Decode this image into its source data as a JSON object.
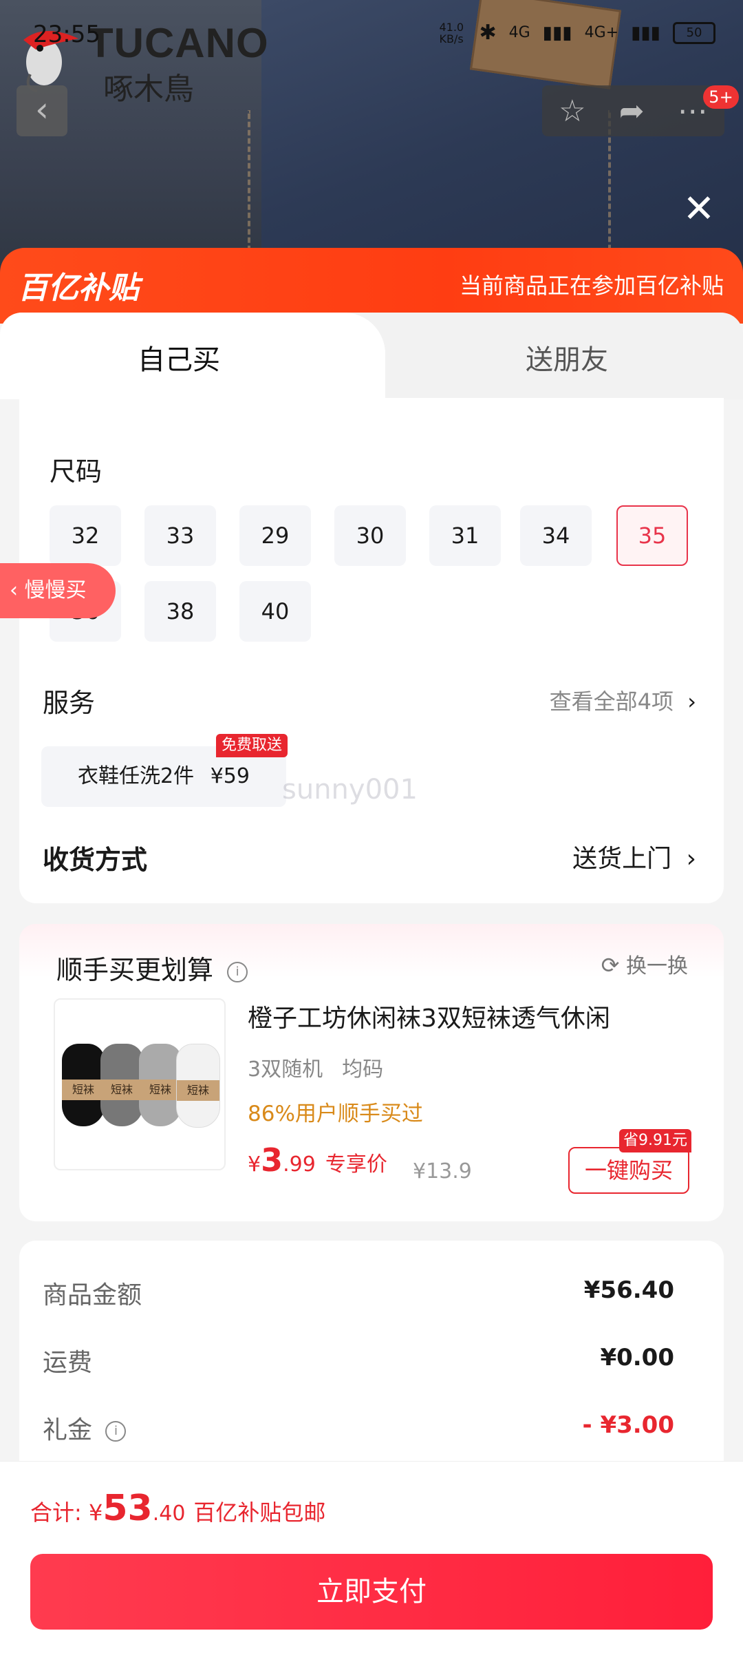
{
  "status": {
    "time": "23:55",
    "net": "41.0 KB/s",
    "sig1": "4G",
    "sig2": "4G+",
    "battery": "50"
  },
  "brand": {
    "word": "TUCANO",
    "cn": "啄木鳥"
  },
  "notifications_badge": "5+",
  "banner": {
    "logo": "百亿补贴",
    "text": "当前商品正在参加百亿补贴"
  },
  "tabs": [
    {
      "label": "自己买"
    },
    {
      "label": "送朋友"
    }
  ],
  "size": {
    "title": "尺码",
    "options": [
      "32",
      "33",
      "29",
      "30",
      "31",
      "34",
      "35",
      "36",
      "38",
      "40"
    ],
    "selected": "35"
  },
  "slow_buy": "慢慢买",
  "service": {
    "title": "服务",
    "view_all": "查看全部4项",
    "item_label": "衣鞋任洗2件",
    "item_price": "¥59",
    "tag": "免费取送"
  },
  "delivery": {
    "title": "收货方式",
    "value": "送货上门"
  },
  "watermark": "sunny001",
  "addon": {
    "title": "顺手买更划算",
    "swap": "换一换",
    "product_name": "橙子工坊休闲袜3双短袜透气休闲",
    "spec1": "3双随机",
    "spec2": "均码",
    "popularity": "86%用户顺手买过",
    "price_currency": "¥",
    "price_int": "3",
    "price_dec": ".99",
    "price_label": "专享价",
    "original_price": "¥13.9",
    "save_tag": "省9.91元",
    "button": "一键购买",
    "sock_label": "短袜"
  },
  "summary": {
    "goods_label": "商品金额",
    "goods_value": "¥56.40",
    "shipping_label": "运费",
    "shipping_value": "¥0.00",
    "gift_label": "礼金",
    "gift_value": "- ¥3.00"
  },
  "footer": {
    "total_label": "合计: ",
    "total_currency": "¥",
    "total_int": "53",
    "total_dec": ".40",
    "total_note": "百亿补贴包邮",
    "pay_button": "立即支付"
  },
  "colors": {
    "accent": "#e8262f",
    "banner": "#ff4b1a",
    "pay": "#ff2a42"
  }
}
